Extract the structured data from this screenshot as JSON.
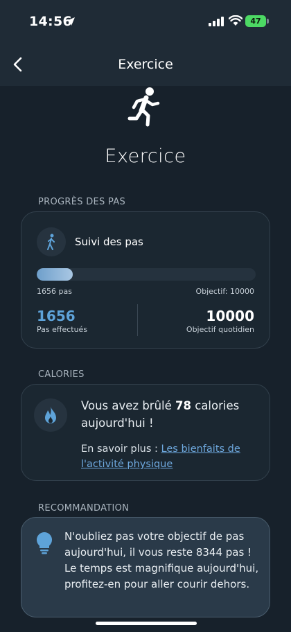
{
  "status": {
    "time": "14:56",
    "battery": "47"
  },
  "nav": {
    "title": "Exercice"
  },
  "page": {
    "title": "Exercice"
  },
  "steps": {
    "section_label": "PROGRÈS DES PAS",
    "heading": "Suivi des pas",
    "progress_fraction": 0.166,
    "count_text": "1656 pas",
    "goal_text": "Objectif: 10000",
    "done_value": "1656",
    "done_label": "Pas effectués",
    "goal_value": "10000",
    "goal_label": "Objectif quotidien"
  },
  "calories": {
    "section_label": "CALORIES",
    "text_before": "Vous avez brûlé ",
    "value": "78",
    "text_after": " calories aujourd'hui !",
    "learn_prefix": "En savoir plus : ",
    "learn_link": "Les bienfaits de l'activité physique"
  },
  "recommendation": {
    "section_label": "RECOMMANDATION",
    "text": "N'oubliez pas votre objectif de pas aujourd'hui, il vous reste 8344 pas ! Le temps est magnifique aujourd'hui, profitez-en pour aller courir dehors."
  },
  "colors": {
    "accent": "#5ea3d9",
    "background": "#17212b",
    "battery": "#4cd964"
  },
  "icons": {
    "back": "chevron-left-icon",
    "hero": "runner-icon",
    "steps": "walking-person-icon",
    "calories": "flame-icon",
    "recommendation": "lightbulb-icon"
  }
}
